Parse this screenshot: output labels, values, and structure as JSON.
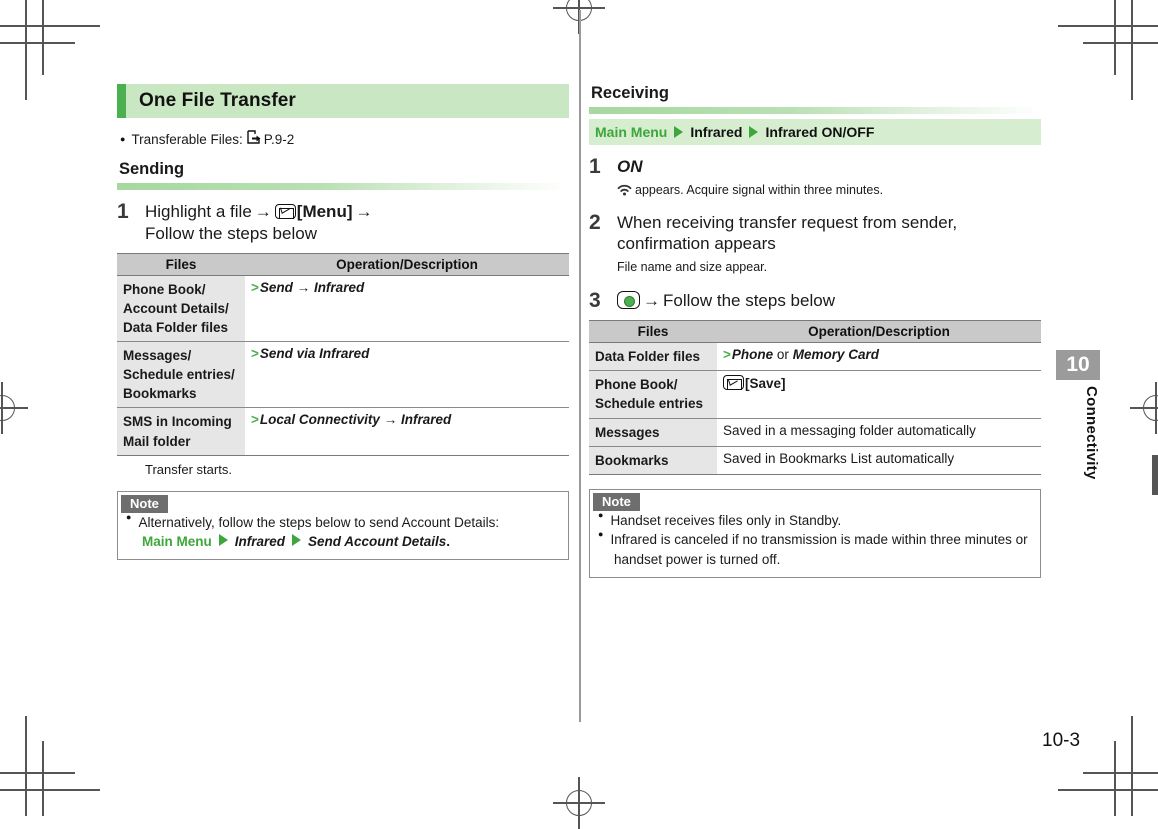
{
  "document": {
    "page_number": "10-3",
    "chapter_number": "10",
    "chapter_name": "Connectivity"
  },
  "colors": {
    "accent_green": "#4caf50",
    "band_green": "#c9e7c2",
    "crumb_green": "#d6edd0",
    "header_gray": "#c9c9c9",
    "cell_gray": "#e6e6e6",
    "note_tag_gray": "#6e6e6e"
  },
  "left": {
    "title": "One File Transfer",
    "transferable": {
      "label": "Transferable Files:",
      "ref_icon": "pointing-hand-icon",
      "ref": "P.9-2"
    },
    "sending_heading": "Sending",
    "step1": {
      "num": "1",
      "line1_a": "Highlight a file",
      "arrow": "→",
      "key_icon": "envelope-key-icon",
      "key_label": "[Menu]",
      "arrow2": "→",
      "line2": "Follow the steps below"
    },
    "table": {
      "headers": [
        "Files",
        "Operation/Description"
      ],
      "rows": [
        {
          "files": "Phone Book/\nAccount Details/\nData Folder files",
          "marker": ">",
          "op_italic": "Send",
          "op_arrow": "→",
          "op_italic2": "Infrared",
          "op_plain": ""
        },
        {
          "files": "Messages/\nSchedule entries/\nBookmarks",
          "marker": ">",
          "op_italic": "Send via Infrared",
          "op_arrow": "",
          "op_italic2": "",
          "op_plain": ""
        },
        {
          "files": "SMS in Incoming\nMail folder",
          "marker": ">",
          "op_italic": "Local Connectivity",
          "op_arrow": "→",
          "op_italic2": "Infrared",
          "op_plain": ""
        }
      ]
    },
    "after_table": "Transfer starts.",
    "note": {
      "tag": "Note",
      "item1": "Alternatively, follow the steps below to send Account Details:",
      "crumb_main": "Main Menu",
      "crumb_1": "Infrared",
      "crumb_2": "Send Account Details",
      "crumb_tail": "."
    }
  },
  "right": {
    "receiving_heading": "Receiving",
    "crumb": {
      "main": "Main Menu",
      "item1": "Infrared",
      "item2": "Infrared ON/OFF"
    },
    "step1": {
      "num": "1",
      "main": "ON",
      "icon": "infrared-signal-icon",
      "sub": "appears. Acquire signal within three minutes."
    },
    "step2": {
      "num": "2",
      "main_line1": "When receiving transfer request from sender,",
      "main_line2": "confirmation appears",
      "sub": "File name and size appear."
    },
    "step3": {
      "num": "3",
      "key_icon": "center-key-icon",
      "arrow": "→",
      "main": "Follow the steps below"
    },
    "table": {
      "headers": [
        "Files",
        "Operation/Description"
      ],
      "rows": [
        {
          "files": "Data Folder files",
          "marker": ">",
          "key_icon": "",
          "op_italic": "Phone",
          "op_conj": "or",
          "op_italic2": "Memory Card",
          "op_plain": ""
        },
        {
          "files": "Phone Book/\nSchedule entries",
          "marker": "",
          "key_icon": "envelope-key-icon",
          "op_italic": "",
          "op_conj": "",
          "op_italic2": "",
          "op_plain": "[Save]"
        },
        {
          "files": "Messages",
          "marker": "",
          "key_icon": "",
          "op_italic": "",
          "op_conj": "",
          "op_italic2": "",
          "op_plain": "Saved in a messaging folder automatically"
        },
        {
          "files": "Bookmarks",
          "marker": "",
          "key_icon": "",
          "op_italic": "",
          "op_conj": "",
          "op_italic2": "",
          "op_plain": "Saved in Bookmarks List automatically"
        }
      ]
    },
    "note": {
      "tag": "Note",
      "item1": "Handset receives files only in Standby.",
      "item2_line1": "Infrared is canceled if no transmission is made within three minutes or",
      "item2_line2": "handset power is turned off."
    }
  }
}
